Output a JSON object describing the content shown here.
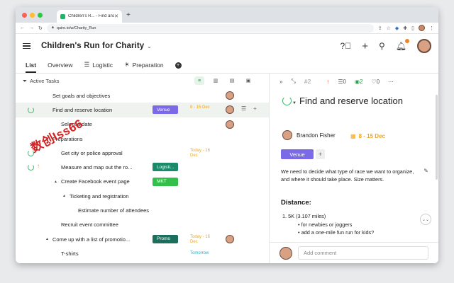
{
  "browser": {
    "tab_title": "Children's R... - Find and reserv",
    "url": "quire.io/w/Charity_Run"
  },
  "header": {
    "project_title": "Children's Run for Charity"
  },
  "nav_tabs": [
    {
      "label": "List"
    },
    {
      "label": "Overview"
    },
    {
      "label": "Logistic"
    },
    {
      "label": "Preparation"
    }
  ],
  "toolbar": {
    "filter_label": "Active Tasks"
  },
  "tasks": [
    {
      "name": "Set goals and objectives",
      "tag": "",
      "date": "",
      "avatar": true
    },
    {
      "name": "Find and reserve location",
      "tag": "Venue",
      "date": "8 - 15 Dec",
      "avatar": true
    },
    {
      "name": "Select a date",
      "tag": "",
      "date": "",
      "avatar": true
    },
    {
      "name": "Preparations",
      "tag": "",
      "date": "",
      "avatar": false
    },
    {
      "name": "Get city or police approval",
      "tag": "",
      "date": "Today - 16 Dec",
      "avatar": false
    },
    {
      "name": "Measure and map out the ro...",
      "tag": "Logisti...",
      "date": "",
      "avatar": false
    },
    {
      "name": "Create Facebook event page",
      "tag": "MKT",
      "date": "",
      "avatar": false
    },
    {
      "name": "Ticketing and registration",
      "tag": "",
      "date": "",
      "avatar": false
    },
    {
      "name": "Estimate number of attendees",
      "tag": "",
      "date": "",
      "avatar": false
    },
    {
      "name": "Recruit event committee",
      "tag": "",
      "date": "",
      "avatar": false
    },
    {
      "name": "Come up with a list of promotio...",
      "tag": "Promo",
      "date": "Today - 16 Dec",
      "avatar": true
    },
    {
      "name": "T-shirts",
      "tag": "",
      "date": "Tomorrow",
      "avatar": false
    }
  ],
  "tag_colors": {
    "Venue": "#7b6ae8",
    "Logisti...": "#1a8a6a",
    "MKT": "#33c04a",
    "Promo": "#1b6f5c"
  },
  "detail": {
    "task_id": "#2",
    "subtask_count": "0",
    "watchers": "2",
    "likes": "0",
    "title": "Find and reserve location",
    "assignee": "Brandon Fisher",
    "date": "8 - 15 Dec",
    "tag": "Venue",
    "description": "We need to decide what type of race we want to organize, and where it should take place. Size matters.",
    "heading": "Distance:",
    "list_item": "1. 5K (3.107 miles)",
    "subitems": [
      "for newbies or joggers",
      "add a one-mile fun run for kids?"
    ],
    "comment_placeholder": "Add comment"
  },
  "watermark": "数创Iss66"
}
